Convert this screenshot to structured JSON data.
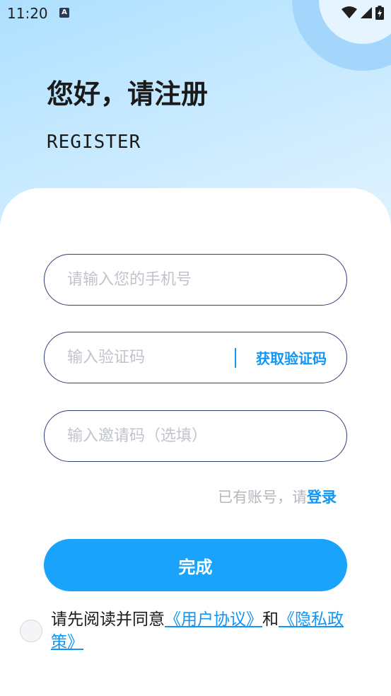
{
  "status_bar": {
    "time": "11:20",
    "notification_icon": "A",
    "icons": [
      "wifi-icon",
      "cellular-signal-icon",
      "battery-charging-icon"
    ]
  },
  "header": {
    "title": "您好，请注册",
    "subtitle": "REGISTER"
  },
  "form": {
    "phone": {
      "placeholder": "请输入您的手机号",
      "value": ""
    },
    "code": {
      "placeholder": "输入验证码",
      "value": "",
      "action_label": "获取验证码"
    },
    "invite": {
      "placeholder": "输入邀请码（选填）",
      "value": ""
    }
  },
  "login_prompt": {
    "text": "已有账号，请",
    "link": "登录"
  },
  "submit_label": "完成",
  "agreement": {
    "checked": false,
    "prefix": "请先阅读并同意",
    "user_agreement": "《用户协议》",
    "conjunction": "和",
    "privacy_policy": "《隐私政策》"
  },
  "colors": {
    "accent": "#1296F5",
    "button": "#1AA3FB",
    "field_border": "#2F3E74",
    "placeholder": "#C1C4CB"
  }
}
